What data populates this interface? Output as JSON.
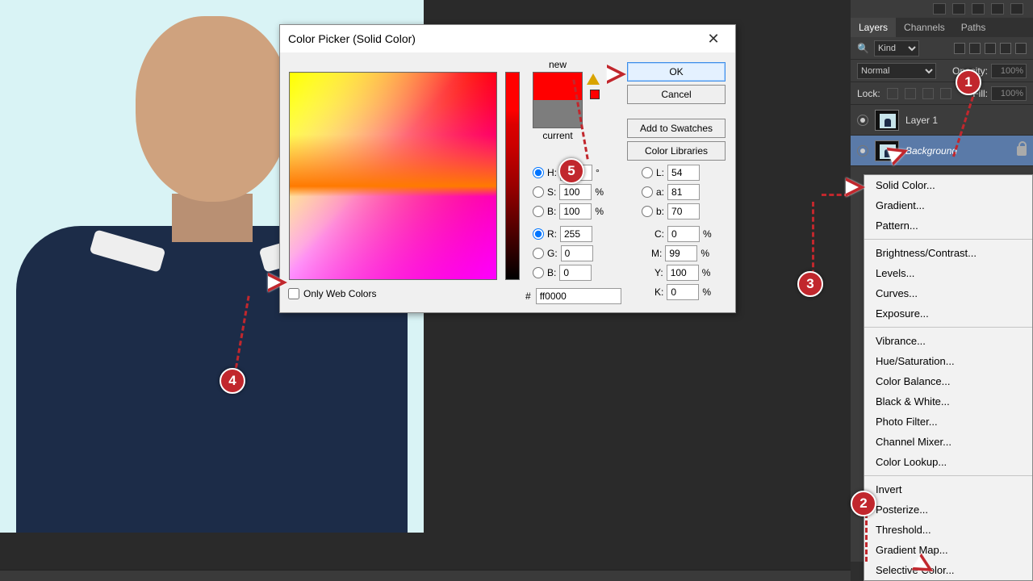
{
  "dialog": {
    "title": "Color Picker (Solid Color)",
    "new_label": "new",
    "current_label": "current",
    "ok_label": "OK",
    "cancel_label": "Cancel",
    "add_swatches_label": "Add to Swatches",
    "color_libraries_label": "Color Libraries",
    "hsb": {
      "h_label": "H:",
      "h": "",
      "h_unit": "°",
      "s_label": "S:",
      "s": "100",
      "s_unit": "%",
      "b_label": "B:",
      "b": "100",
      "b_unit": "%"
    },
    "lab": {
      "l_label": "L:",
      "l": "54",
      "a_label": "a:",
      "a": "81",
      "b_label": "b:",
      "b": "70"
    },
    "rgb": {
      "r_label": "R:",
      "r": "255",
      "g_label": "G:",
      "g": "0",
      "b_label": "B:",
      "b": "0"
    },
    "cmyk": {
      "c_label": "C:",
      "c": "0",
      "m_label": "M:",
      "m": "99",
      "y_label": "Y:",
      "y": "100",
      "k_label": "K:",
      "k": "0",
      "unit": "%"
    },
    "only_web_label": "Only Web Colors",
    "hex_label": "#",
    "hex_value": "ff0000"
  },
  "panel": {
    "tabs": {
      "layers": "Layers",
      "channels": "Channels",
      "paths": "Paths"
    },
    "kind_label": "Kind",
    "blend_mode": "Normal",
    "opacity_label": "Opacity:",
    "opacity_value": "100%",
    "fill_label": "Fill:",
    "fill_value": "100%",
    "lock_label": "Lock:",
    "search_icon": "🔍",
    "layers": [
      {
        "name": "Layer 1"
      },
      {
        "name": "Background"
      }
    ]
  },
  "context_menu": {
    "items": [
      "Solid Color...",
      "Gradient...",
      "Pattern...",
      "-",
      "Brightness/Contrast...",
      "Levels...",
      "Curves...",
      "Exposure...",
      "-",
      "Vibrance...",
      "Hue/Saturation...",
      "Color Balance...",
      "Black & White...",
      "Photo Filter...",
      "Channel Mixer...",
      "Color Lookup...",
      "-",
      "Invert",
      "Posterize...",
      "Threshold...",
      "Gradient Map...",
      "Selective Color..."
    ]
  },
  "markers": {
    "m1": "1",
    "m2": "2",
    "m3": "3",
    "m4": "4",
    "m5": "5"
  }
}
